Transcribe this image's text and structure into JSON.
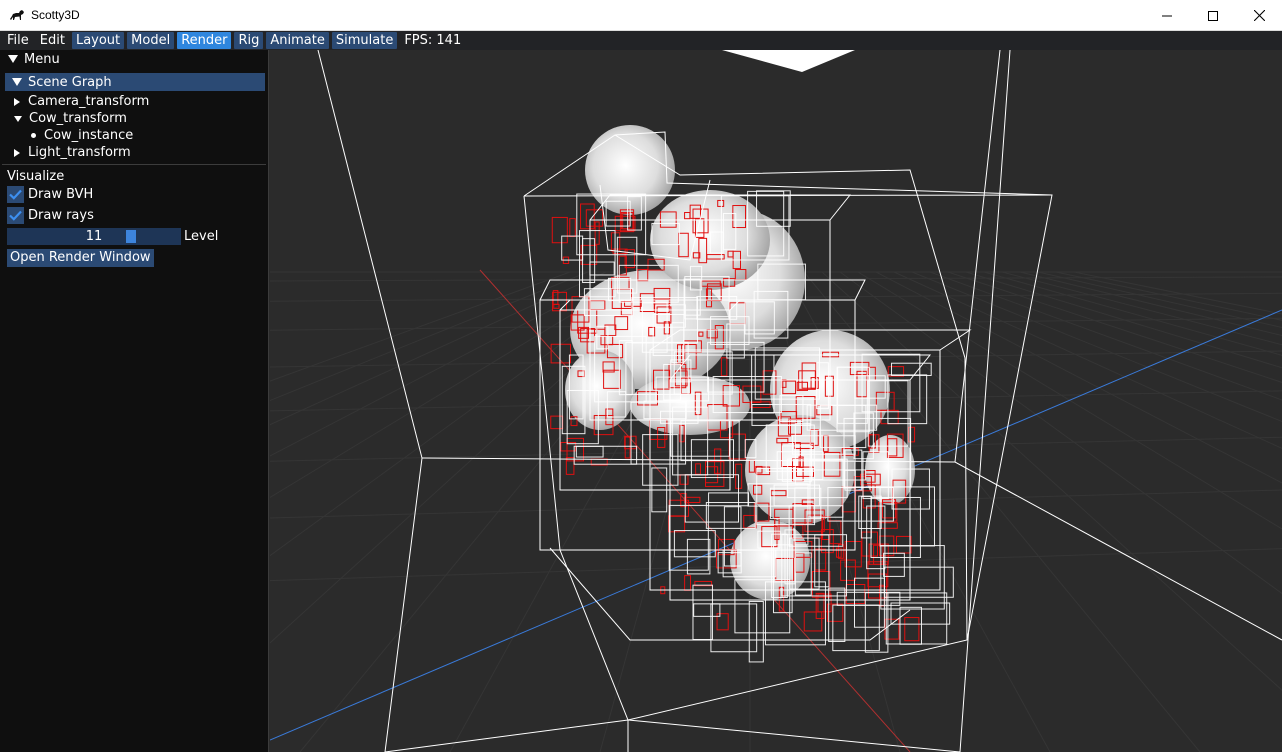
{
  "window": {
    "title": "Scotty3D",
    "icons": {
      "app": "dog-icon",
      "minimize": "minimize-icon",
      "maximize": "maximize-icon",
      "close": "close-icon"
    }
  },
  "menubar": {
    "items": [
      {
        "label": "File",
        "style": "plain"
      },
      {
        "label": "Edit",
        "style": "plain"
      },
      {
        "label": "Layout",
        "style": "boxed"
      },
      {
        "label": "Model",
        "style": "boxed"
      },
      {
        "label": "Render",
        "style": "active"
      },
      {
        "label": "Rig",
        "style": "boxed"
      },
      {
        "label": "Animate",
        "style": "boxed"
      },
      {
        "label": "Simulate",
        "style": "boxed"
      }
    ],
    "fps": "FPS: 141"
  },
  "panel": {
    "title": "Menu",
    "scene_graph": {
      "title": "Scene Graph",
      "nodes": [
        {
          "label": "Camera_transform",
          "expanded": false
        },
        {
          "label": "Cow_transform",
          "expanded": true,
          "children": [
            {
              "label": "Cow_instance"
            }
          ]
        },
        {
          "label": "Light_transform",
          "expanded": false
        }
      ]
    },
    "visualize": {
      "label": "Visualize",
      "draw_bvh": {
        "label": "Draw BVH",
        "checked": true
      },
      "draw_rays": {
        "label": "Draw rays",
        "checked": true
      },
      "level": {
        "label": "Level",
        "value": "11"
      }
    },
    "open_render_window": "Open Render Window"
  },
  "colors": {
    "accent": "#2f86de",
    "widget": "#2b4a74",
    "panel_bg": "#0f0f0f",
    "viewport_bg": "#2b2b2b",
    "bvh_lines": "#ffffff",
    "rays": "#ff0000",
    "axis_x": "#b03030",
    "axis_z": "#3a7ad8"
  }
}
